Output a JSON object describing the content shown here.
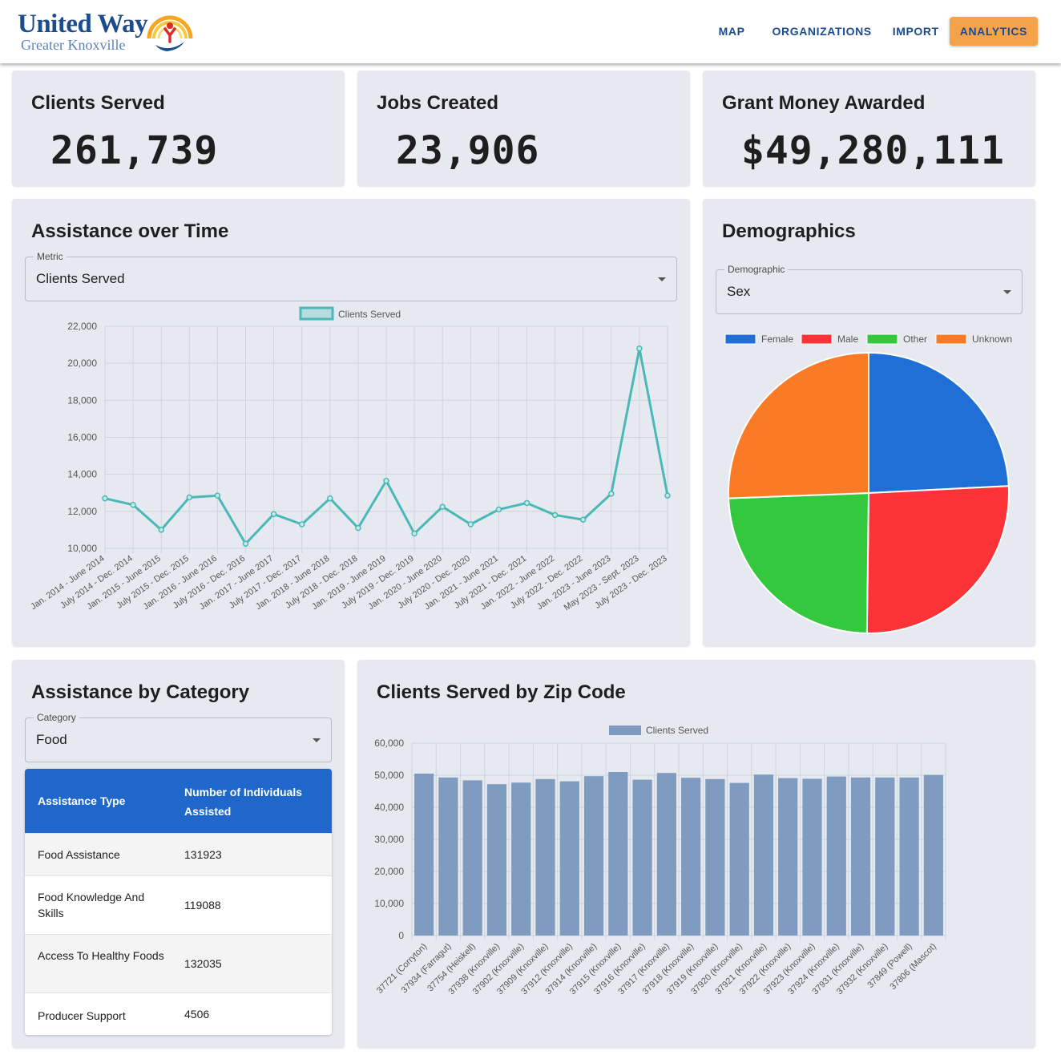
{
  "header": {
    "logo_line1": "United Way",
    "logo_line2": "Greater Knoxville",
    "nav": [
      "MAP",
      "ORGANIZATIONS",
      "IMPORT",
      "ANALYTICS"
    ],
    "active_nav": "ANALYTICS",
    "accent": "#f5a34a",
    "brand": "#1d4b8f"
  },
  "stats": [
    {
      "title": "Clients Served",
      "value": "261,739"
    },
    {
      "title": "Jobs Created",
      "value": "23,906"
    },
    {
      "title": "Grant Money Awarded",
      "value": "$49,280,111"
    }
  ],
  "time_card": {
    "title": "Assistance over Time",
    "select_label": "Metric",
    "select_value": "Clients Served"
  },
  "demo_card": {
    "title": "Demographics",
    "select_label": "Demographic",
    "select_value": "Sex"
  },
  "category_card": {
    "title": "Assistance by Category",
    "select_label": "Category",
    "select_value": "Food",
    "table": {
      "headers": [
        "Assistance Type",
        "Number of Individuals Assisted"
      ],
      "rows": [
        [
          "Food Assistance",
          "131923"
        ],
        [
          "Food Knowledge And Skills",
          "119088"
        ],
        [
          "Access To Healthy Foods",
          "132035"
        ],
        [
          "Producer Support",
          "4506"
        ]
      ]
    }
  },
  "zip_card": {
    "title": "Clients Served by Zip Code"
  },
  "chart_data": [
    {
      "type": "line",
      "series": [
        {
          "name": "Clients Served",
          "color": "#4bb8b8",
          "values": [
            12700,
            12350,
            11000,
            12750,
            12850,
            10250,
            11850,
            11300,
            12700,
            11100,
            13650,
            10800,
            12250,
            11300,
            12100,
            12450,
            11800,
            11550,
            12950,
            20800,
            12850
          ]
        }
      ],
      "categories": [
        "Jan. 2014 - June 2014",
        "July 2014 - Dec. 2014",
        "Jan. 2015 - June 2015",
        "July 2015 - Dec. 2015",
        "Jan. 2016 - June 2016",
        "July 2016 - Dec. 2016",
        "Jan. 2017 - June 2017",
        "July 2017 - Dec. 2017",
        "Jan. 2018 - June 2018",
        "July 2018 - Dec. 2018",
        "Jan. 2019 - June 2019",
        "July 2019 - Dec. 2019",
        "Jan. 2020 - June 2020",
        "July 2020 - Dec. 2020",
        "Jan. 2021 - June 2021",
        "July 2021 - Dec. 2021",
        "Jan. 2022 - June 2022",
        "July 2022 - Dec. 2022",
        "Jan. 2023 - June 2023",
        "May 2023 - Sept. 2023",
        "July 2023 - Dec. 2023"
      ],
      "ylim": [
        10000,
        22000
      ],
      "yticks": [
        "22,000",
        "20,000",
        "18,000",
        "16,000",
        "14,000",
        "12,000",
        "10,000"
      ],
      "legend_position": "top",
      "grid": true
    },
    {
      "type": "pie",
      "labels": [
        "Female",
        "Male",
        "Other",
        "Unknown"
      ],
      "values": [
        24.2,
        26.0,
        24.2,
        25.6
      ],
      "colors": [
        "#1f6fd6",
        "#fb3236",
        "#33c83d",
        "#fb7a26"
      ],
      "legend_position": "top"
    },
    {
      "type": "bar",
      "series": [
        {
          "name": "Clients Served",
          "color": "#7f9cc0",
          "values": [
            50500,
            49300,
            48400,
            47200,
            47700,
            48800,
            48100,
            49700,
            51000,
            48600,
            50700,
            49200,
            48800,
            47600,
            50200,
            49100,
            48900,
            49600,
            49300,
            49300,
            49300,
            50100
          ]
        }
      ],
      "categories": [
        "37721 (Corryton)",
        "37934 (Farragut)",
        "37754 (Heiskell)",
        "37938 (Knoxville)",
        "37902 (Knoxville)",
        "37909 (Knoxville)",
        "37912 (Knoxville)",
        "37914 (Knoxville)",
        "37915 (Knoxville)",
        "37916 (Knoxville)",
        "37917 (Knoxville)",
        "37918 (Knoxville)",
        "37919 (Knoxville)",
        "37920 (Knoxville)",
        "37921 (Knoxville)",
        "37922 (Knoxville)",
        "37923 (Knoxville)",
        "37924 (Knoxville)",
        "37931 (Knoxville)",
        "37932 (Knoxville)",
        "37849 (Powell)",
        "37806 (Mascot)"
      ],
      "ylim": [
        0,
        60000
      ],
      "yticks": [
        "60,000",
        "50,000",
        "40,000",
        "30,000",
        "20,000",
        "10,000",
        "0"
      ],
      "legend_position": "top",
      "grid": true
    }
  ]
}
